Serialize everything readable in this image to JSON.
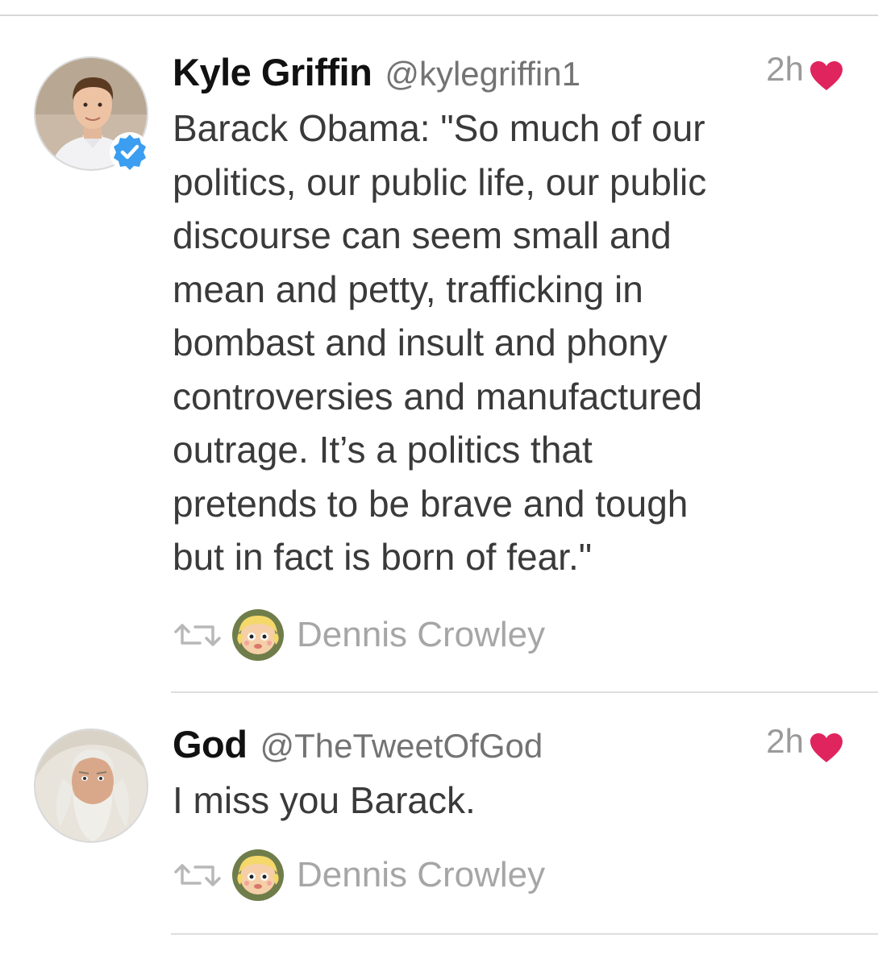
{
  "tweets": [
    {
      "display_name": "Kyle Griffin",
      "handle": "@kylegriffin1",
      "time": "2h",
      "verified": true,
      "liked": true,
      "text_lines": [
        "Barack Obama: \"So much of our",
        "politics, our public life, our public",
        "discourse can seem small and",
        "mean and petty, trafficking in",
        "bombast and insult and phony",
        "controversies and manufactured",
        "outrage. It’s a politics that",
        "pretends to be brave and tough",
        "but in fact is born of fear.\""
      ],
      "social_context": {
        "icon": "retweet-icon",
        "name": "Dennis Crowley"
      }
    },
    {
      "display_name": "God",
      "handle": "@TheTweetOfGod",
      "time": "2h",
      "verified": false,
      "liked": true,
      "text_lines": [
        "I miss you Barack."
      ],
      "social_context": {
        "icon": "retweet-icon",
        "name": "Dennis Crowley"
      }
    }
  ],
  "colors": {
    "heart": "#e0245e",
    "verified": "#3b9ef0",
    "secondary_text": "#9a9a9a",
    "body_text": "#3a3a3a"
  }
}
